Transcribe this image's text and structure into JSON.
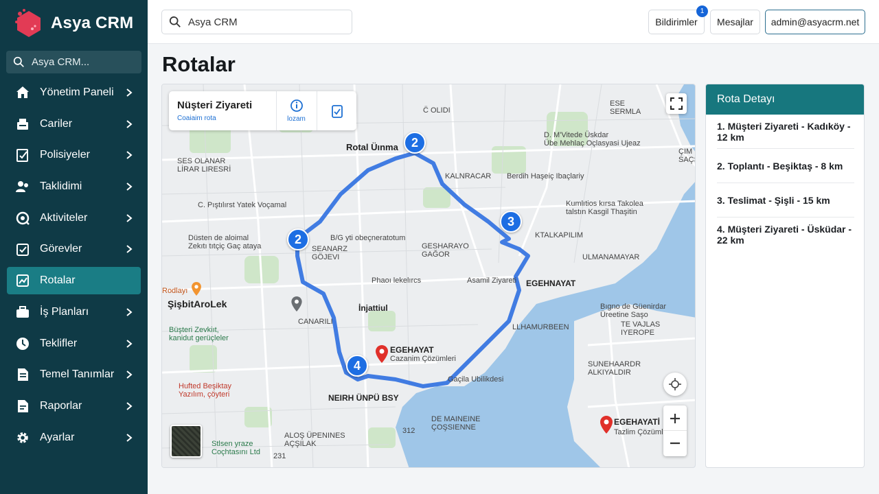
{
  "app": {
    "name": "Asya CRM"
  },
  "sidebar": {
    "search_placeholder": "Asya CRM...",
    "items": [
      {
        "label": "Yönetim Paneli",
        "icon": "home-icon",
        "chevron": true,
        "active": false
      },
      {
        "label": "Cariler",
        "icon": "contacts-icon",
        "chevron": true,
        "active": false
      },
      {
        "label": "Polisiyeler",
        "icon": "policy-icon",
        "chevron": true,
        "active": false
      },
      {
        "label": "Taklidimi",
        "icon": "users-icon",
        "chevron": true,
        "active": false
      },
      {
        "label": "Aktiviteler",
        "icon": "activity-icon",
        "chevron": true,
        "active": false
      },
      {
        "label": "Görevler",
        "icon": "task-icon",
        "chevron": true,
        "active": false
      },
      {
        "label": "Rotalar",
        "icon": "route-icon",
        "chevron": false,
        "active": true
      },
      {
        "label": "İş Planları",
        "icon": "briefcase-icon",
        "chevron": true,
        "active": false
      },
      {
        "label": "Teklifler",
        "icon": "clock-icon",
        "chevron": true,
        "active": false
      },
      {
        "label": "Temel Tanımlar",
        "icon": "document-icon",
        "chevron": true,
        "active": false
      },
      {
        "label": "Raporlar",
        "icon": "report-icon",
        "chevron": true,
        "active": false
      },
      {
        "label": "Ayarlar",
        "icon": "gear-icon",
        "chevron": true,
        "active": false
      }
    ]
  },
  "topbar": {
    "search_value": "Asya CRM",
    "notifications_label": "Bildirimler",
    "notifications_count": "1",
    "messages_label": "Mesajlar",
    "user_email": "admin@asyacrm.net"
  },
  "page": {
    "title": "Rotalar"
  },
  "map": {
    "card": {
      "title": "Nüşteri Ziyareti",
      "subtitle": "Coaiaim rota",
      "action_label": "lozam"
    },
    "route_label": "Rotal Üınma",
    "markers": [
      "2",
      "2",
      "3",
      "4"
    ],
    "labels": {
      "l1": "C̈ OLIDI",
      "l2": "ESE\nSERMLA",
      "l3": "D. M'Vitede Üskdar\nÜbe Mehlaç Oçlasyasi Ujeaz",
      "l4": "SES OLANAR\nLİRAR LIRESRİ",
      "l5": "KALNRACAR",
      "l6": "Berdih Haşeiç Ibaçlariy",
      "l7": "C. Pıştılırst Yatek Voçamal",
      "l8": "Kumlıtios kırsa Takolea\ntalstın Kasgil Thaşitin",
      "l9": "Düsten de aloimal\nZekıtı tıtçiç Gaç ataya",
      "l10": "B/G yti obeçneratotum",
      "l11": "GESHARAYO\nGAĞOR",
      "l12": "KTALKAPILIM",
      "l13": "SEANARZ\nGÖJEVI",
      "l14": "ULMANAMAYAR",
      "l15": "Phaoı lekelırcs",
      "l16": "Asamil Ziyareti",
      "l17": "EGEHNAYAT",
      "l18": "Rodlayı",
      "l19": "ŞişbitAroLek",
      "l20": "İnjattiul",
      "l21": "CANARILI",
      "l22": "Bıgno de Güenirdar\nÜreetine Saşo",
      "l23": "LLHAMURBEEN",
      "l24": "Büşteri Zevkiıt,\nkanidut gerüçleler",
      "l25": "EGEHAYAT",
      "l26": "Cazanim Çözümleri",
      "l27": "SUNEHAARDR\nALKIYALDIR",
      "l28": "Hufted Beşiktay\nYazılım, çöyteri",
      "l29": "Gaçila Ubilikdesi",
      "l30": "NEIRH ÜNPÜ BSY",
      "l31": "DE MAINEINE\nÇOŞSIENNE",
      "l32": "312",
      "l33": "EGEHAYATİ",
      "l34": "Tazlim Çözümleri",
      "l35": "ALOŞ ÜPENINES\nAÇŞILAK",
      "l36": "Stlsen yraze\nCoçhtasını Ltd",
      "l37": "231",
      "l38": "TE VAJLAS\nIYEROPE",
      "l39": "ÇIM\nSAÇS"
    }
  },
  "route_detail": {
    "title": "Rota Detayı",
    "items": [
      "1. Müşteri Ziyareti - Kadıköy - 12 km",
      "2. Toplantı - Beşiktaş - 8 km",
      "3. Teslimat - Şişli - 15 km",
      "4. Müşteri Ziyareti - Üsküdar - 22 km"
    ]
  },
  "colors": {
    "sidebar": "#0f3a46",
    "active": "#1a7d85",
    "route": "#2f6fe0",
    "water": "#9fc6e8",
    "header": "#17777e"
  }
}
